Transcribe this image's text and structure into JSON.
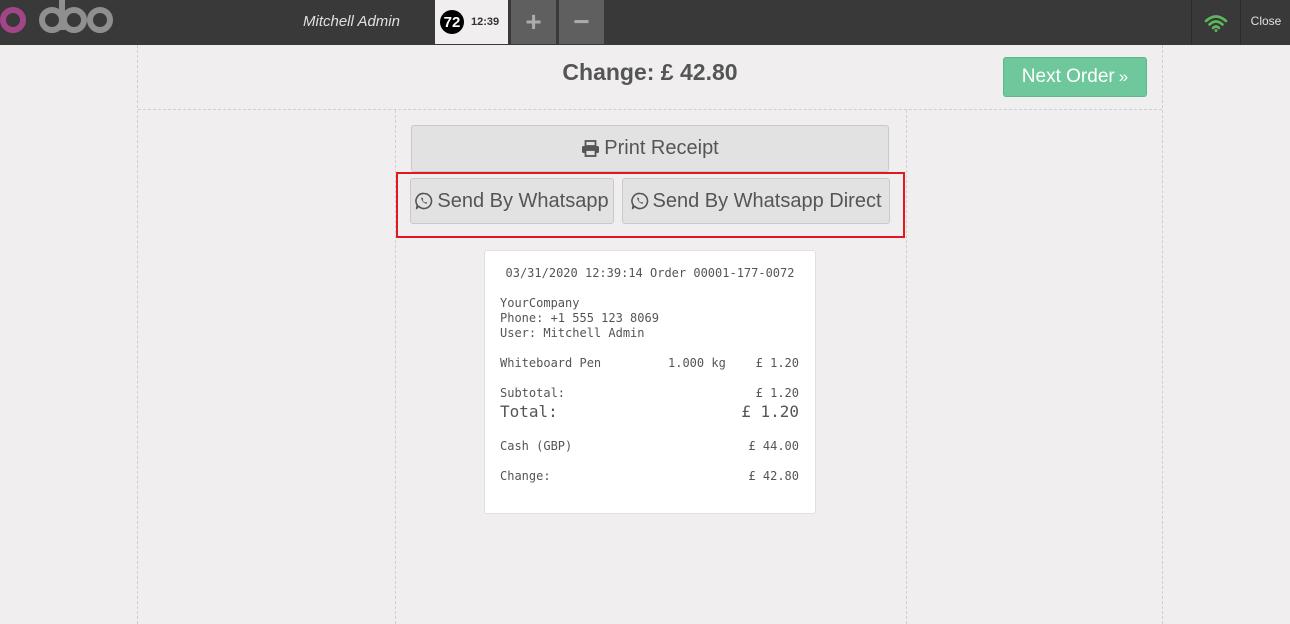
{
  "topbar": {
    "user_name": "Mitchell Admin",
    "order_number": "72",
    "order_time": "12:39",
    "add_label": "+",
    "remove_label": "−",
    "close_label": "Close",
    "wifi_color": "#5cb85c"
  },
  "header": {
    "change_title": "Change: £ 42.80",
    "next_order_label": "Next Order",
    "next_order_icon": "»"
  },
  "actions": {
    "print_label": "Print Receipt",
    "whatsapp_label": "Send By Whatsapp",
    "whatsapp_direct_label": "Send By Whatsapp Direct",
    "highlight_color": "#e0191e"
  },
  "receipt": {
    "header_line": "03/31/2020 12:39:14 Order 00001-177-0072",
    "company": "YourCompany",
    "phone": "Phone: +1 555 123 8069",
    "user": "User: Mitchell Admin",
    "line_product": "Whiteboard Pen",
    "line_qty": "1.000 kg",
    "line_price": "£ 1.20",
    "subtotal_label": "Subtotal:",
    "subtotal_value": "£ 1.20",
    "total_label": "Total:",
    "total_value": "£ 1.20",
    "payment_label": "Cash (GBP)",
    "payment_value": "£ 44.00",
    "change_label": "Change:",
    "change_value": "£ 42.80"
  }
}
